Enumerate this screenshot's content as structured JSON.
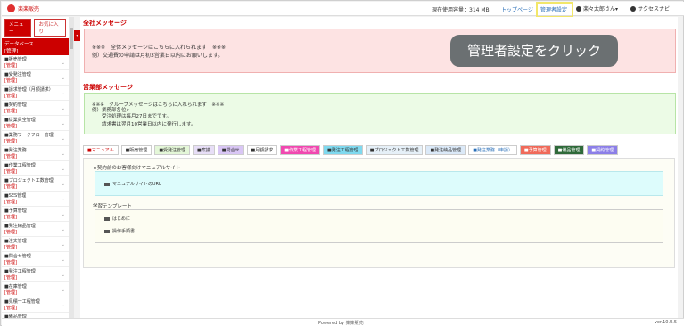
{
  "app": {
    "logo_text": "楽楽販売"
  },
  "topbar": {
    "usage": "現在使用容量：314 MB",
    "links": [
      "トップページ",
      "管理者設定"
    ],
    "user": "楽々太郎さん▾",
    "help": "サクセスナビ"
  },
  "sidebar": {
    "buttons": [
      "メニュー",
      "お気に入り"
    ],
    "head": {
      "title": "データベース",
      "sub": "[管理]"
    },
    "items": [
      {
        "title": "■販売管理",
        "sub": "[管理]"
      },
      {
        "title": "■受発注管理",
        "sub": "[管理]"
      },
      {
        "title": "■請求管理（月額請求）",
        "sub": "[管理]"
      },
      {
        "title": "■契約管理",
        "sub": "[管理]"
      },
      {
        "title": "■従業員全管理",
        "sub": "[管理]"
      },
      {
        "title": "■業務ワークフロー管理",
        "sub": "[管理]"
      },
      {
        "title": "■発注業務",
        "sub": "[管理]"
      },
      {
        "title": "■作業工程管理",
        "sub": "[管理]"
      },
      {
        "title": "■プロジェクト工数管理",
        "sub": "[管理]"
      },
      {
        "title": "■SES管理",
        "sub": "[管理]"
      },
      {
        "title": "■予算管理",
        "sub": "[管理]"
      },
      {
        "title": "■発注納品管理",
        "sub": "[管理]"
      },
      {
        "title": "■注文管理",
        "sub": "[管理]"
      },
      {
        "title": "■問合せ管理",
        "sub": "[管理]"
      },
      {
        "title": "■発注工程管理",
        "sub": "[管理]"
      },
      {
        "title": "■在庫管理",
        "sub": "[管理]"
      },
      {
        "title": "■見積一工程管理",
        "sub": "[管理]"
      },
      {
        "title": "■備品管理",
        "sub": "[管理]"
      }
    ]
  },
  "main": {
    "global_title": "全社メッセージ",
    "global_lines": [
      "※※※　全体メッセージはこちらに入れられます　※※※",
      "例）交通費の申請は月初3営業日以内にお願いします。"
    ],
    "dept_title": "営業部メッセージ",
    "dept_lines": [
      "※※※　グループメッセージはこちらに入れられます　※※※",
      "例）業務部各位>\n　　受注処理は毎月27日までです。",
      "　　請求書は翌月10営業日以内に発行します。"
    ],
    "tabs": [
      {
        "label": "■マニュアル",
        "bg": "#ffffff",
        "fg": "#c00"
      },
      {
        "label": "■販売管理",
        "bg": "#ffffff",
        "fg": "#333"
      },
      {
        "label": "■受発注管理",
        "bg": "#e4f7d8",
        "fg": "#333"
      },
      {
        "label": "■案議",
        "bg": "#e7def7",
        "fg": "#333"
      },
      {
        "label": "■問合せ",
        "bg": "#d9c6f5",
        "fg": "#333"
      },
      {
        "label": "■月額請求",
        "bg": "#ffffff",
        "fg": "#333"
      },
      {
        "label": "■作業工程管理",
        "bg": "#f048b0",
        "fg": "#fff"
      },
      {
        "label": "■発注工程管理",
        "bg": "#7fd9ef",
        "fg": "#333"
      },
      {
        "label": "■プロジェクト工数管理",
        "bg": "#e6f0f8",
        "fg": "#333"
      },
      {
        "label": "■発注納品管理",
        "bg": "#dbe9f8",
        "fg": "#333"
      },
      {
        "label": "■発注業務（申請）",
        "bg": "#ffffff",
        "fg": "#2a6fb8"
      },
      {
        "label": "■予算管理",
        "bg": "#f06a5a",
        "fg": "#fff"
      },
      {
        "label": "■備品管理",
        "bg": "#2f6a3a",
        "fg": "#fff"
      },
      {
        "label": "■契約管理",
        "bg": "#8c7fe8",
        "fg": "#fff"
      }
    ],
    "panel": {
      "section1_label": "★契約前のお客様向けマニュアルサイト",
      "section1_items": [
        "マニュアルサイトのURL"
      ],
      "section2_label": "学習テンプレート",
      "section2_items": [
        "はじめに",
        "操作手順書"
      ]
    }
  },
  "footer": {
    "powered": "Powered by 楽楽販売",
    "version": "ver.10.5.5"
  },
  "callout": {
    "text": "管理者設定をクリック"
  },
  "colors": {
    "brand": "#cc0000",
    "highlight": "#f2e76a"
  }
}
